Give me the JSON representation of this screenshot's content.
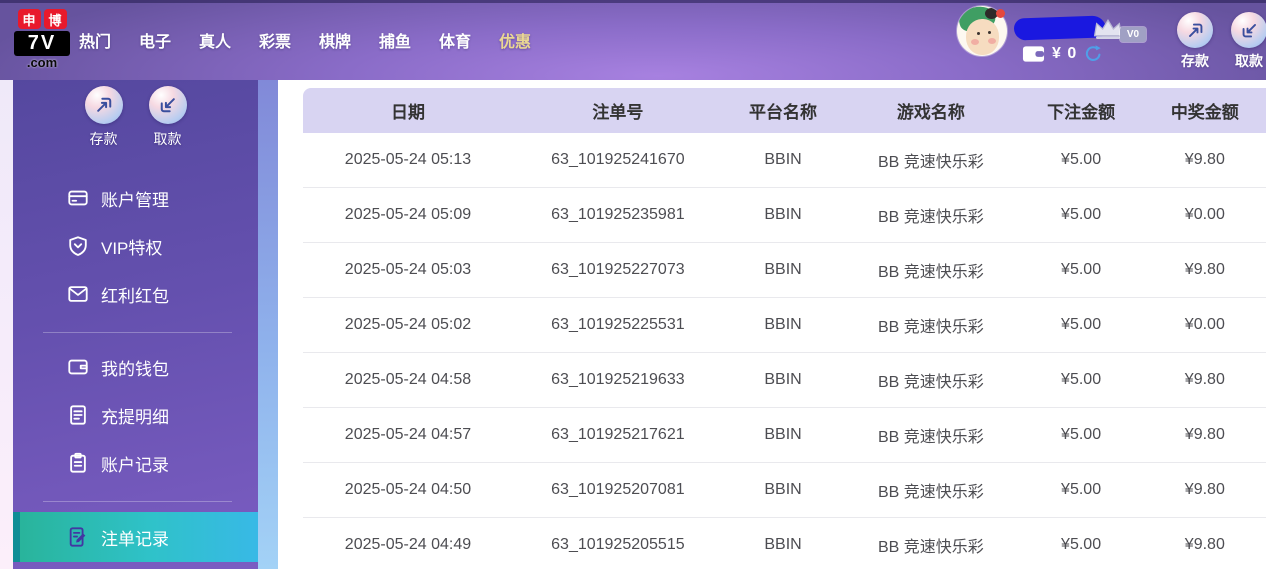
{
  "topbar": {
    "logo": {
      "badge_left": "申",
      "badge_right": "博",
      "main": "7V",
      "suffix": ".com"
    },
    "nav": [
      {
        "label": "热门",
        "active": false
      },
      {
        "label": "电子",
        "active": false
      },
      {
        "label": "真人",
        "active": false
      },
      {
        "label": "彩票",
        "active": false
      },
      {
        "label": "棋牌",
        "active": false
      },
      {
        "label": "捕鱼",
        "active": false
      },
      {
        "label": "体育",
        "active": false
      },
      {
        "label": "优惠",
        "active": true
      }
    ],
    "user": {
      "vip_level": "V0",
      "balance": "¥ 0"
    },
    "deposit_label": "存款",
    "withdraw_label": "取款"
  },
  "sidebar": {
    "deposit_label": "存款",
    "withdraw_label": "取款",
    "groups": [
      {
        "items": [
          {
            "label": "账户管理",
            "icon": "card-icon",
            "active": false
          },
          {
            "label": "VIP特权",
            "icon": "vip-icon",
            "active": false
          },
          {
            "label": "红利红包",
            "icon": "envelope-icon",
            "active": false
          }
        ]
      },
      {
        "items": [
          {
            "label": "我的钱包",
            "icon": "wallet-icon",
            "active": false
          },
          {
            "label": "充提明细",
            "icon": "document-icon",
            "active": false
          },
          {
            "label": "账户记录",
            "icon": "clipboard-icon",
            "active": false
          }
        ]
      },
      {
        "items": [
          {
            "label": "注单记录",
            "icon": "bet-record-icon",
            "active": true
          }
        ]
      }
    ]
  },
  "table": {
    "headers": [
      "日期",
      "注单号",
      "平台名称",
      "游戏名称",
      "下注金额",
      "中奖金额"
    ],
    "rows": [
      [
        "2025-05-24 05:13",
        "63_101925241670",
        "BBIN",
        "BB 竞速快乐彩",
        "¥5.00",
        "¥9.80"
      ],
      [
        "2025-05-24 05:09",
        "63_101925235981",
        "BBIN",
        "BB 竞速快乐彩",
        "¥5.00",
        "¥0.00"
      ],
      [
        "2025-05-24 05:03",
        "63_101925227073",
        "BBIN",
        "BB 竞速快乐彩",
        "¥5.00",
        "¥9.80"
      ],
      [
        "2025-05-24 05:02",
        "63_101925225531",
        "BBIN",
        "BB 竞速快乐彩",
        "¥5.00",
        "¥0.00"
      ],
      [
        "2025-05-24 04:58",
        "63_101925219633",
        "BBIN",
        "BB 竞速快乐彩",
        "¥5.00",
        "¥9.80"
      ],
      [
        "2025-05-24 04:57",
        "63_101925217621",
        "BBIN",
        "BB 竞速快乐彩",
        "¥5.00",
        "¥9.80"
      ],
      [
        "2025-05-24 04:50",
        "63_101925207081",
        "BBIN",
        "BB 竞速快乐彩",
        "¥5.00",
        "¥9.80"
      ],
      [
        "2025-05-24 04:49",
        "63_101925205515",
        "BBIN",
        "BB 竞速快乐彩",
        "¥5.00",
        "¥9.80"
      ]
    ]
  },
  "colors": {
    "topbar_purple": "#8a6cc8",
    "sidebar_purple": "#6450ae",
    "active_item_gradient_from": "#29b49b",
    "active_item_gradient_to": "#38b9e6",
    "table_header_bg": "#d8d4f2",
    "nav_active_gold": "#ead793",
    "logo_red": "#e8192c",
    "username_scribble_blue": "#1a18e0",
    "refresh_blue": "#4f9fe8"
  }
}
